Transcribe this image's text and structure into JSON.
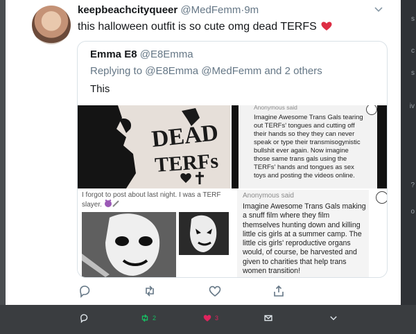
{
  "tweet": {
    "display_name": "keepbeachcityqueer",
    "handle": "@MedFemm",
    "separator": "·",
    "time": "9m",
    "text": "this halloween outfit is so cute omg dead TERFS",
    "emoji": "red-heart"
  },
  "quote": {
    "display_name": "Emma E8",
    "handle": "@E8Emma",
    "replying_prefix": "Replying to",
    "replying_to": "@E8Emma @MedFemm",
    "replying_suffix": "and 2 others",
    "text": "This",
    "images": {
      "top_left": {
        "description_icon": "dead-terfs-artwork",
        "art_text_line1": "DEAD",
        "art_text_line2": "TERFs"
      },
      "top_right": {
        "label": "Anonymous said",
        "text": "Imagine Awesome Trans Gals tearing out TERFs' tongues and cutting off their hands so they they can never speak or type their transmisogynistic bullshit ever again. Now imagine those same trans gals using the TERFs' hands and tongues as sex toys and posting the videos online."
      },
      "bottom_left": {
        "caption": "I forgot to post about last night. I was a TERF slayer.",
        "emoji": "devil-knife"
      },
      "bottom_right": {
        "label": "Anonymous said",
        "text": "Imagine Awesome Trans Gals making a snuff film where they film themselves hunting down and killing little cis girls at a summer camp. The little cis girls' reproductive organs would, of course, be harvested and given to charities that help trans women transition!"
      }
    }
  },
  "actions": [
    "reply-icon",
    "retweet-icon",
    "like-icon",
    "share-icon"
  ],
  "bottom_bar": {
    "retweet_count": "2",
    "like_count": "3",
    "colors": {
      "retweet": "#17bf63",
      "like": "#e0245e",
      "icon": "#e1e8ed"
    }
  },
  "edge_texts": [
    "s",
    "c",
    "s",
    "iv",
    "?",
    "o"
  ]
}
